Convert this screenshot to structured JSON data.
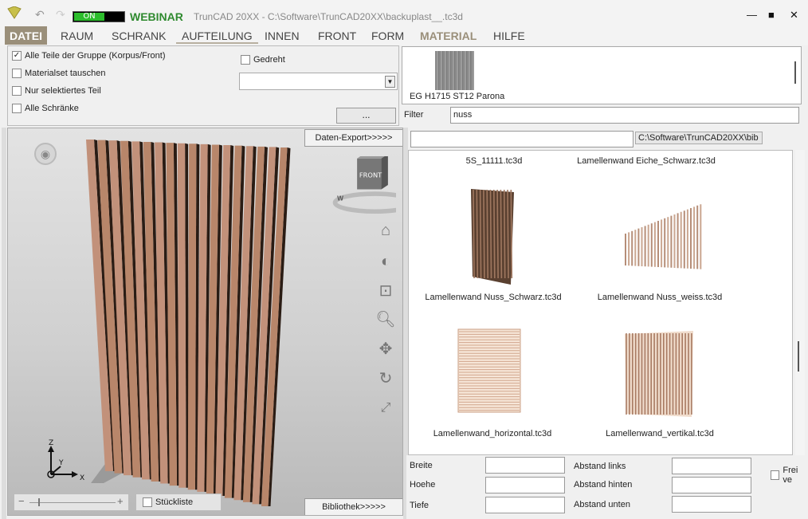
{
  "titlebar": {
    "toggle_label": "ON",
    "webinar_label": "WEBINAR",
    "window_title": "TrunCAD 20XX - C:\\Software\\TrunCAD20XX\\backuplast__.tc3d",
    "minimize": "—",
    "maximize": "■",
    "close": "✕"
  },
  "menu": {
    "items": [
      "DATEI",
      "RAUM",
      "SCHRANK",
      "AUFTEILUNG",
      "INNEN",
      "FRONT",
      "FORM",
      "MATERIAL",
      "HILFE"
    ]
  },
  "options": {
    "checkboxes": [
      {
        "label": "Alle Teile der Gruppe (Korpus/Front)",
        "checked": true
      },
      {
        "label": "Materialset tauschen",
        "checked": false
      },
      {
        "label": "Nur selektiertes Teil",
        "checked": false
      },
      {
        "label": "Alle Schränke",
        "checked": false
      }
    ],
    "gedreht": {
      "label": "Gedreht",
      "checked": false
    },
    "combo_value": "",
    "dots_button": "..."
  },
  "material": {
    "name": "EG H1715 ST12 Parona",
    "swatch_color": "#8f8f8f"
  },
  "filter": {
    "label": "Filter",
    "value": "nuss"
  },
  "viewport": {
    "export_button": "Daten-Export>>>>>",
    "library_button": "Bibliothek>>>>>",
    "cube_face": "FRONT",
    "stueckliste_label": "Stückliste",
    "axes": {
      "z": "Z",
      "y": "Y",
      "x": "X"
    },
    "zoom_minus": "−",
    "zoom_plus": "+"
  },
  "library": {
    "path_value": "",
    "path_label": "C:\\Software\\TrunCAD20XX\\bib",
    "items": [
      {
        "caption": "5S_11111.tc3d"
      },
      {
        "caption": "Lamellenwand Eiche_Schwarz.tc3d"
      },
      {
        "caption": "Lamellenwand Nuss_Schwarz.tc3d"
      },
      {
        "caption": "Lamellenwand Nuss_weiss.tc3d"
      },
      {
        "caption": "Lamellenwand_horizontal.tc3d"
      },
      {
        "caption": "Lamellenwand_vertikal.tc3d"
      }
    ]
  },
  "dimensions": {
    "breite": "Breite",
    "hoehe": "Hoehe",
    "tiefe": "Tiefe",
    "abstand_links": "Abstand links",
    "abstand_hinten": "Abstand hinten",
    "abstand_unten": "Abstand unten",
    "frei_label": "Frei ve"
  }
}
